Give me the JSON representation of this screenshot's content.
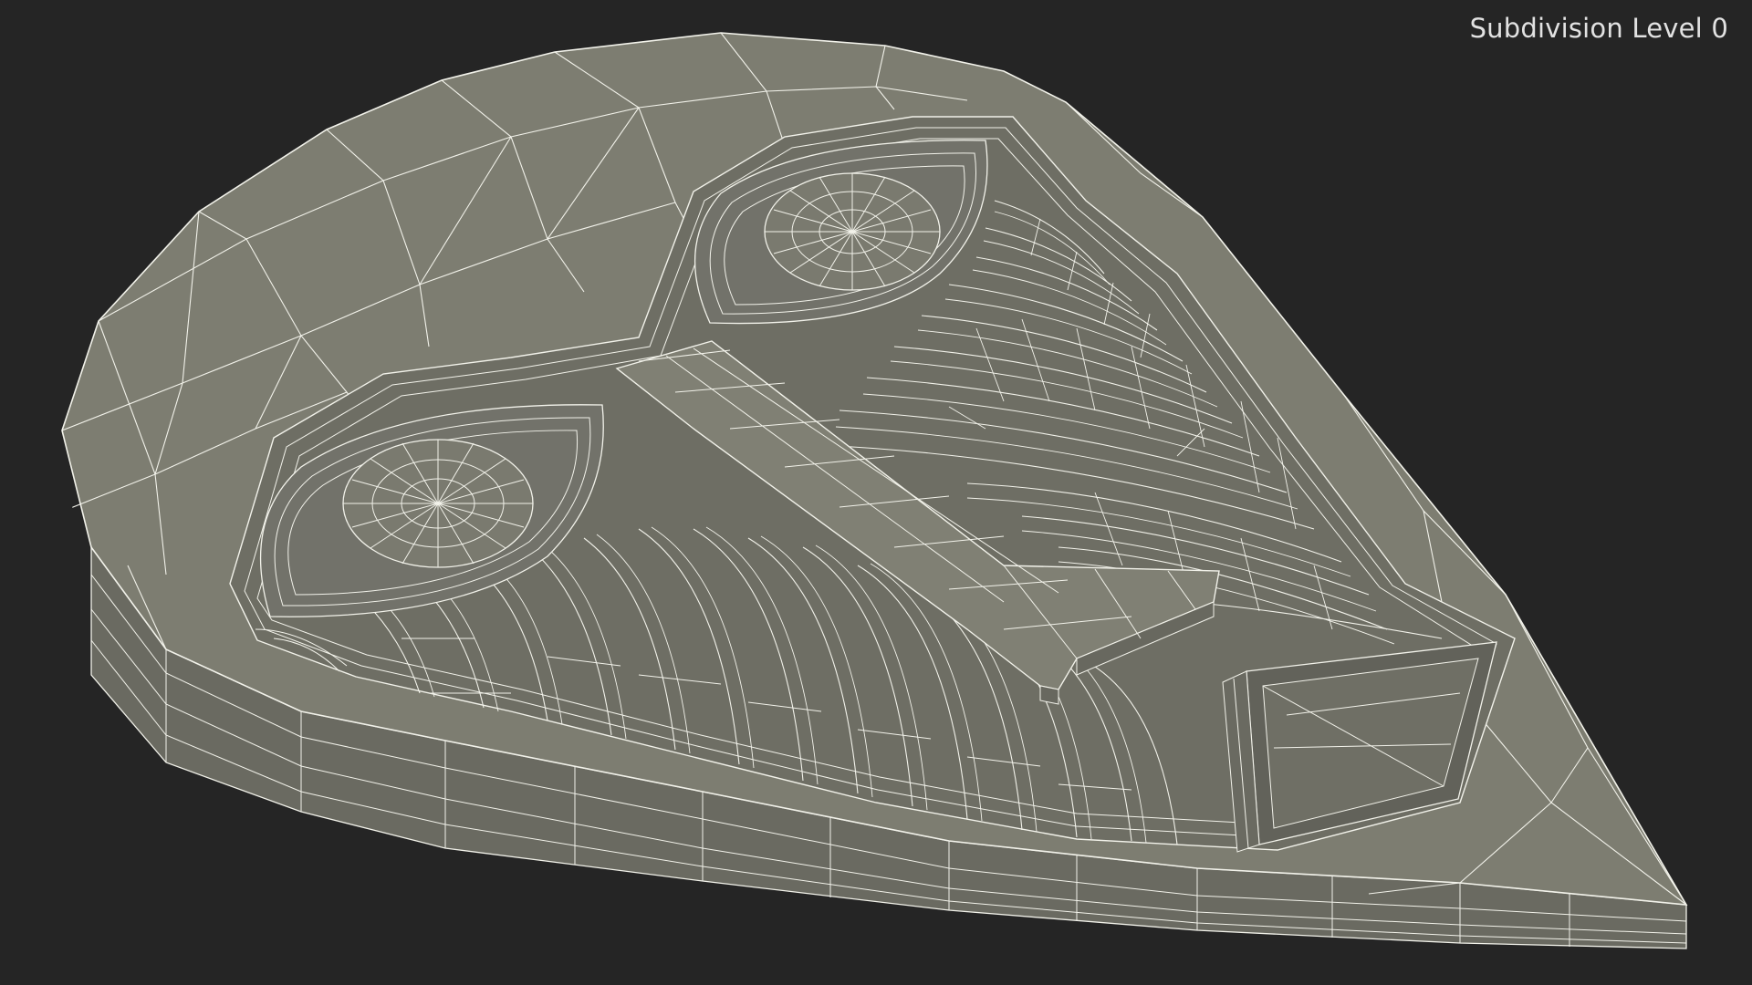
{
  "overlay": {
    "subdivision_label": "Subdivision Level 0"
  },
  "colors": {
    "background": "#252525",
    "surface": "#7b7b6f",
    "surface_light": "#86867a",
    "surface_dark": "#5f5f56",
    "wire": "#f2f2ea",
    "label": "#e2e2e2"
  }
}
